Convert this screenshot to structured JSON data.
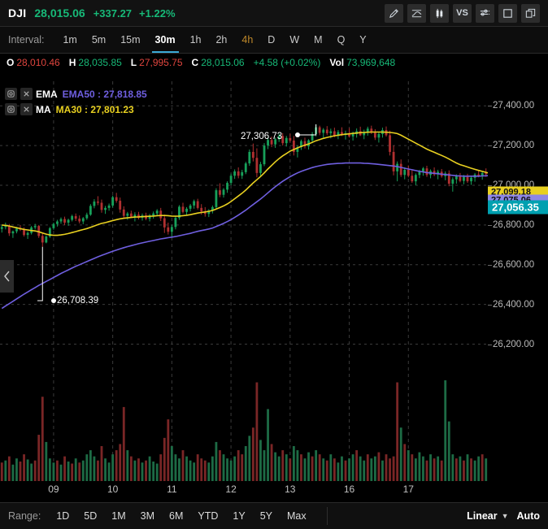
{
  "quote": {
    "symbol": "DJI",
    "last": "28,015.06",
    "change": "+337.27",
    "change_percent": "+1.22%",
    "up_color": "#17b978",
    "down_color": "#e0453e"
  },
  "toolbar": {
    "items": [
      {
        "name": "draw-pencil-icon",
        "label": ""
      },
      {
        "name": "indicator-line-icon",
        "label": ""
      },
      {
        "name": "candlestick-icon",
        "label": ""
      },
      {
        "name": "compare-vs-icon",
        "label": "VS"
      },
      {
        "name": "settings-sliders-icon",
        "label": ""
      },
      {
        "name": "fullscreen-icon",
        "label": ""
      },
      {
        "name": "layers-icon",
        "label": ""
      }
    ]
  },
  "interval": {
    "label": "Interval:",
    "items": [
      {
        "label": "1m",
        "state": "normal"
      },
      {
        "label": "5m",
        "state": "normal"
      },
      {
        "label": "15m",
        "state": "normal"
      },
      {
        "label": "30m",
        "state": "active"
      },
      {
        "label": "1h",
        "state": "normal"
      },
      {
        "label": "2h",
        "state": "normal"
      },
      {
        "label": "4h",
        "state": "highlight"
      },
      {
        "label": "D",
        "state": "normal"
      },
      {
        "label": "W",
        "state": "normal"
      },
      {
        "label": "M",
        "state": "normal"
      },
      {
        "label": "Q",
        "state": "normal"
      },
      {
        "label": "Y",
        "state": "normal"
      }
    ]
  },
  "ohlc": {
    "open_key": "O",
    "open_value": "28,010.46",
    "high_key": "H",
    "high_value": "28,035.85",
    "low_key": "L",
    "low_value": "27,995.75",
    "close_key": "C",
    "close_value": "28,015.06",
    "change": "+4.58 (+0.02%)",
    "volume_key": "Vol",
    "volume_value": "73,969,648"
  },
  "indicators": [
    {
      "name": "EMA",
      "series": "EMA50 : 27,818.85",
      "color": "#6f5fe0"
    },
    {
      "name": "MA",
      "series": "MA30 : 27,801.23",
      "color": "#e8d020"
    }
  ],
  "price_tags": {
    "ma": "27,099.18",
    "ema": "27,075.06",
    "last": "27,056.35"
  },
  "annotations": {
    "high": "27,306.73",
    "low": "26,708.39"
  },
  "range": {
    "label": "Range:",
    "items": [
      "1D",
      "5D",
      "1M",
      "3M",
      "6M",
      "YTD",
      "1Y",
      "5Y",
      "Max"
    ],
    "scale": "Linear",
    "auto": "Auto"
  },
  "chart_data": {
    "type": "candlestick",
    "title": "DJI 30m",
    "xlabel": "",
    "ylabel": "",
    "ylim": [
      26100,
      27450
    ],
    "yticks": [
      27400,
      27200,
      27000,
      26800,
      26600,
      26400,
      26200
    ],
    "ytick_labels": [
      "27,400.00",
      "27,200.00",
      "27,000.00",
      "26,800.00",
      "26,600.00",
      "26,400.00",
      "26,200.00"
    ],
    "grid": true,
    "x_tick_labels": [
      "09",
      "10",
      "11",
      "12",
      "13",
      "16",
      "17"
    ],
    "x_tick_indices": [
      14,
      30,
      46,
      62,
      78,
      94,
      110
    ],
    "up_color": "#17a05a",
    "down_color": "#b03030",
    "ma30_color": "#e8d020",
    "ema50_color": "#6f5fe0",
    "candles": [
      [
        26780,
        26800,
        26762,
        26790
      ],
      [
        26790,
        26812,
        26778,
        26795
      ],
      [
        26795,
        26805,
        26745,
        26758
      ],
      [
        26758,
        26772,
        26735,
        26768
      ],
      [
        26768,
        26790,
        26758,
        26782
      ],
      [
        26782,
        26800,
        26770,
        26776
      ],
      [
        26776,
        26788,
        26742,
        26750
      ],
      [
        26750,
        26768,
        26730,
        26760
      ],
      [
        26760,
        26795,
        26752,
        26788
      ],
      [
        26788,
        26806,
        26778,
        26795
      ],
      [
        26795,
        26800,
        26735,
        26745
      ],
      [
        26745,
        26760,
        26690,
        26712
      ],
      [
        26712,
        26748,
        26708,
        26742
      ],
      [
        26742,
        26790,
        26735,
        26784
      ],
      [
        26784,
        26812,
        26776,
        26805
      ],
      [
        26805,
        26826,
        26792,
        26818
      ],
      [
        26818,
        26838,
        26806,
        26830
      ],
      [
        26830,
        26842,
        26800,
        26812
      ],
      [
        26812,
        26832,
        26796,
        26826
      ],
      [
        26826,
        26852,
        26818,
        26845
      ],
      [
        26845,
        26858,
        26820,
        26832
      ],
      [
        26832,
        26848,
        26808,
        26818
      ],
      [
        26818,
        26840,
        26804,
        26834
      ],
      [
        26834,
        26862,
        26826,
        26852
      ],
      [
        26852,
        26905,
        26846,
        26896
      ],
      [
        26896,
        26930,
        26884,
        26918
      ],
      [
        26918,
        26945,
        26900,
        26912
      ],
      [
        26912,
        26928,
        26862,
        26876
      ],
      [
        26876,
        26896,
        26856,
        26886
      ],
      [
        26886,
        26908,
        26872,
        26898
      ],
      [
        26898,
        26948,
        26888,
        26940
      ],
      [
        26940,
        26962,
        26912,
        26922
      ],
      [
        26922,
        26938,
        26862,
        26878
      ],
      [
        26878,
        26894,
        26832,
        26846
      ],
      [
        26846,
        26866,
        26826,
        26858
      ],
      [
        26858,
        26872,
        26836,
        26842
      ],
      [
        26842,
        26864,
        26818,
        26852
      ],
      [
        26852,
        26866,
        26828,
        26836
      ],
      [
        26836,
        26858,
        26822,
        26848
      ],
      [
        26848,
        26862,
        26824,
        26832
      ],
      [
        26832,
        26856,
        26818,
        26846
      ],
      [
        26846,
        26868,
        26832,
        26858
      ],
      [
        26858,
        26880,
        26845,
        26872
      ],
      [
        26872,
        26886,
        26820,
        26834
      ],
      [
        26834,
        26852,
        26760,
        26788
      ],
      [
        26788,
        26812,
        26752,
        26766
      ],
      [
        26766,
        26800,
        26742,
        26790
      ],
      [
        26790,
        26842,
        26778,
        26836
      ],
      [
        26836,
        26900,
        26826,
        26892
      ],
      [
        26892,
        26912,
        26858,
        26866
      ],
      [
        26866,
        26890,
        26848,
        26882
      ],
      [
        26882,
        26906,
        26868,
        26898
      ],
      [
        26898,
        26928,
        26882,
        26920
      ],
      [
        26920,
        26932,
        26878,
        26886
      ],
      [
        26886,
        26905,
        26852,
        26868
      ],
      [
        26868,
        26890,
        26842,
        26856
      ],
      [
        26856,
        26880,
        26840,
        26872
      ],
      [
        26872,
        26898,
        26858,
        26890
      ],
      [
        26890,
        26985,
        26882,
        26975
      ],
      [
        26975,
        27010,
        26940,
        26952
      ],
      [
        26952,
        26986,
        26938,
        26978
      ],
      [
        26978,
        27020,
        26962,
        27012
      ],
      [
        27012,
        27058,
        27000,
        27048
      ],
      [
        27048,
        27080,
        27032,
        27070
      ],
      [
        27070,
        27090,
        27035,
        27048
      ],
      [
        27048,
        27078,
        27032,
        27066
      ],
      [
        27066,
        27118,
        27056,
        27110
      ],
      [
        27110,
        27180,
        27098,
        27168
      ],
      [
        27168,
        27210,
        27120,
        27138
      ],
      [
        27138,
        27186,
        27040,
        27062
      ],
      [
        27062,
        27118,
        27042,
        27106
      ],
      [
        27106,
        27212,
        27096,
        27200
      ],
      [
        27200,
        27240,
        27182,
        27228
      ],
      [
        27228,
        27245,
        27192,
        27206
      ],
      [
        27206,
        27240,
        27188,
        27232
      ],
      [
        27232,
        27260,
        27218,
        27248
      ],
      [
        27248,
        27262,
        27200,
        27212
      ],
      [
        27212,
        27248,
        27195,
        27238
      ],
      [
        27238,
        27260,
        27216,
        27225
      ],
      [
        27225,
        27248,
        27150,
        27168
      ],
      [
        27168,
        27200,
        27140,
        27192
      ],
      [
        27192,
        27230,
        27178,
        27222
      ],
      [
        27222,
        27240,
        27185,
        27196
      ],
      [
        27196,
        27232,
        27180,
        27226
      ],
      [
        27226,
        27268,
        27212,
        27258
      ],
      [
        27258,
        27307,
        27246,
        27292
      ],
      [
        27292,
        27300,
        27252,
        27264
      ],
      [
        27264,
        27288,
        27240,
        27280
      ],
      [
        27280,
        27298,
        27252,
        27262
      ],
      [
        27262,
        27285,
        27236,
        27272
      ],
      [
        27272,
        27290,
        27242,
        27250
      ],
      [
        27250,
        27278,
        27232,
        27268
      ],
      [
        27268,
        27292,
        27248,
        27255
      ],
      [
        27255,
        27275,
        27230,
        27262
      ],
      [
        27262,
        27288,
        27240,
        27246
      ],
      [
        27246,
        27270,
        27225,
        27258
      ],
      [
        27258,
        27286,
        27240,
        27272
      ],
      [
        27272,
        27295,
        27248,
        27252
      ],
      [
        27252,
        27280,
        27232,
        27268
      ],
      [
        27268,
        27295,
        27250,
        27285
      ],
      [
        27285,
        27300,
        27258,
        27265
      ],
      [
        27265,
        27282,
        27228,
        27240
      ],
      [
        27240,
        27268,
        27215,
        27258
      ],
      [
        27258,
        27290,
        27240,
        27278
      ],
      [
        27278,
        27296,
        27245,
        27252
      ],
      [
        27252,
        27275,
        27150,
        27168
      ],
      [
        27168,
        27200,
        27050,
        27070
      ],
      [
        27070,
        27120,
        27020,
        27108
      ],
      [
        27108,
        27130,
        27042,
        27052
      ],
      [
        27052,
        27090,
        27030,
        27078
      ],
      [
        27078,
        27100,
        27040,
        27048
      ],
      [
        27048,
        27075,
        27012,
        27020
      ],
      [
        27020,
        27060,
        27000,
        27052
      ],
      [
        27052,
        27078,
        27036,
        27068
      ],
      [
        27068,
        27092,
        27048,
        27085
      ],
      [
        27085,
        27098,
        27042,
        27052
      ],
      [
        27052,
        27080,
        27035,
        27072
      ],
      [
        27072,
        27090,
        27046,
        27055
      ],
      [
        27055,
        27078,
        27030,
        27068
      ],
      [
        27068,
        27082,
        27038,
        27046
      ],
      [
        27046,
        27070,
        27025,
        27060
      ],
      [
        27060,
        27075,
        26995,
        27008
      ],
      [
        27008,
        27040,
        26968,
        27030
      ],
      [
        27030,
        27055,
        27008,
        27046
      ],
      [
        27046,
        27062,
        27015,
        27022
      ],
      [
        27022,
        27052,
        27005,
        27042
      ],
      [
        27042,
        27058,
        27012,
        27020
      ],
      [
        27020,
        27046,
        27002,
        27038
      ],
      [
        27038,
        27062,
        27018,
        27054
      ],
      [
        27054,
        27078,
        27040,
        27046
      ],
      [
        27046,
        27070,
        27028,
        27062
      ],
      [
        27062,
        27085,
        27042,
        27056
      ]
    ],
    "volumes": [
      18,
      20,
      24,
      16,
      22,
      19,
      26,
      21,
      17,
      20,
      45,
      82,
      38,
      22,
      18,
      20,
      16,
      24,
      19,
      17,
      22,
      18,
      20,
      26,
      30,
      24,
      20,
      34,
      22,
      18,
      26,
      30,
      36,
      72,
      30,
      24,
      20,
      22,
      18,
      20,
      24,
      19,
      17,
      26,
      42,
      60,
      34,
      26,
      22,
      30,
      24,
      20,
      18,
      26,
      22,
      20,
      18,
      24,
      38,
      30,
      26,
      22,
      20,
      24,
      30,
      26,
      34,
      44,
      52,
      96,
      40,
      30,
      70,
      36,
      28,
      24,
      30,
      26,
      22,
      34,
      30,
      26,
      22,
      28,
      24,
      30,
      26,
      22,
      20,
      26,
      22,
      18,
      24,
      20,
      22,
      26,
      30,
      24,
      20,
      26,
      22,
      24,
      28,
      20,
      26,
      22,
      24,
      96,
      52,
      36,
      30,
      26,
      22,
      28,
      24,
      20,
      26,
      22,
      24,
      20,
      98,
      58,
      26,
      22,
      24,
      20,
      26,
      22,
      20,
      24,
      26,
      22,
      20
    ],
    "volume_colors": [
      "d",
      "u",
      "d",
      "u",
      "u",
      "d",
      "d",
      "u",
      "u",
      "d",
      "d",
      "d",
      "u",
      "u",
      "u",
      "d",
      "u",
      "d",
      "u",
      "d",
      "u",
      "d",
      "u",
      "u",
      "u",
      "u",
      "d",
      "d",
      "u",
      "u",
      "u",
      "d",
      "d",
      "d",
      "u",
      "d",
      "u",
      "d",
      "u",
      "d",
      "u",
      "u",
      "u",
      "d",
      "d",
      "d",
      "u",
      "u",
      "u",
      "d",
      "u",
      "u",
      "u",
      "d",
      "d",
      "d",
      "u",
      "u",
      "u",
      "d",
      "u",
      "u",
      "u",
      "u",
      "d",
      "d",
      "u",
      "u",
      "d",
      "d",
      "u",
      "u",
      "u",
      "d",
      "u",
      "u",
      "d",
      "u",
      "d",
      "u",
      "u",
      "d",
      "u",
      "u",
      "d",
      "u",
      "d",
      "u",
      "d",
      "u",
      "d",
      "u",
      "u",
      "d",
      "u",
      "u",
      "d",
      "u",
      "u",
      "d",
      "u",
      "u",
      "d",
      "u",
      "d",
      "d",
      "d",
      "d",
      "u",
      "d",
      "u",
      "d",
      "u",
      "u",
      "u",
      "d",
      "u",
      "d",
      "u",
      "d",
      "u",
      "u",
      "u",
      "d",
      "u",
      "d",
      "u",
      "d",
      "u",
      "u",
      "d",
      "u",
      "u"
    ],
    "ma30": [
      26800,
      26798,
      26795,
      26790,
      26786,
      26782,
      26778,
      26775,
      26772,
      26770,
      26766,
      26760,
      26754,
      26750,
      26748,
      26748,
      26750,
      26753,
      26757,
      26762,
      26767,
      26772,
      26777,
      26782,
      26788,
      26795,
      26802,
      26808,
      26812,
      26817,
      26822,
      26827,
      26831,
      26834,
      26836,
      26838,
      26840,
      26841,
      26842,
      26843,
      26844,
      26845,
      26847,
      26848,
      26848,
      26847,
      26845,
      26844,
      26845,
      26847,
      26849,
      26852,
      26856,
      26860,
      26863,
      26866,
      26869,
      26873,
      26880,
      26888,
      26896,
      26906,
      26918,
      26932,
      26946,
      26960,
      26976,
      26994,
      27012,
      27028,
      27044,
      27062,
      27082,
      27100,
      27118,
      27134,
      27148,
      27160,
      27172,
      27180,
      27188,
      27196,
      27202,
      27208,
      27216,
      27224,
      27230,
      27236,
      27241,
      27245,
      27249,
      27252,
      27255,
      27257,
      27259,
      27261,
      27263,
      27265,
      27266,
      27267,
      27268,
      27268,
      27268,
      27268,
      27267,
      27266,
      27264,
      27260,
      27252,
      27242,
      27232,
      27222,
      27212,
      27202,
      27192,
      27182,
      27174,
      27166,
      27158,
      27150,
      27142,
      27132,
      27122,
      27112,
      27104,
      27098,
      27092,
      27086,
      27080,
      27075,
      27070,
      27065,
      27060
    ],
    "ema50": [
      26380,
      26392,
      26404,
      26416,
      26428,
      26440,
      26452,
      26463,
      26474,
      26485,
      26496,
      26506,
      26516,
      26526,
      26536,
      26546,
      26556,
      26565,
      26574,
      26583,
      26592,
      26600,
      26608,
      26616,
      26624,
      26632,
      26640,
      26647,
      26654,
      26661,
      26668,
      26674,
      26680,
      26686,
      26691,
      26696,
      26701,
      26706,
      26710,
      26714,
      26718,
      26722,
      26726,
      26730,
      26733,
      26736,
      26739,
      26742,
      26746,
      26750,
      26754,
      26758,
      26763,
      26768,
      26772,
      26776,
      26780,
      26785,
      26792,
      26800,
      26808,
      26817,
      26827,
      26838,
      26850,
      26862,
      26875,
      26889,
      26903,
      26917,
      26931,
      26946,
      26962,
      26978,
      26993,
      27007,
      27020,
      27032,
      27043,
      27053,
      27062,
      27070,
      27077,
      27083,
      27089,
      27094,
      27098,
      27102,
      27105,
      27107,
      27109,
      27110,
      27111,
      27112,
      27112,
      27112,
      27112,
      27112,
      27111,
      27110,
      27109,
      27107,
      27105,
      27103,
      27101,
      27099,
      27097,
      27094,
      27090,
      27086,
      27082,
      27078,
      27074,
      27070,
      27067,
      27064,
      27062,
      27060,
      27058,
      27056,
      27054,
      27052,
      27050,
      27048,
      27047,
      27046,
      27046,
      27046,
      27046,
      27046,
      27047,
      27048,
      27049
    ]
  }
}
